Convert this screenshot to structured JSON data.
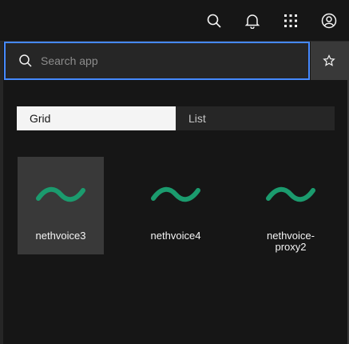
{
  "header": {
    "icons": [
      "search-icon",
      "notification-icon",
      "app-switcher-icon",
      "user-avatar-icon"
    ]
  },
  "search": {
    "placeholder": "Search app",
    "value": ""
  },
  "view_switch": {
    "grid_label": "Grid",
    "list_label": "List",
    "selected": "Grid"
  },
  "apps": [
    {
      "label": "nethvoice3"
    },
    {
      "label": "nethvoice4"
    },
    {
      "label": "nethvoice-\nproxy2"
    }
  ],
  "colors": {
    "accent": "#4589ff",
    "logo": "#1b9b6e",
    "background": "#161616"
  }
}
